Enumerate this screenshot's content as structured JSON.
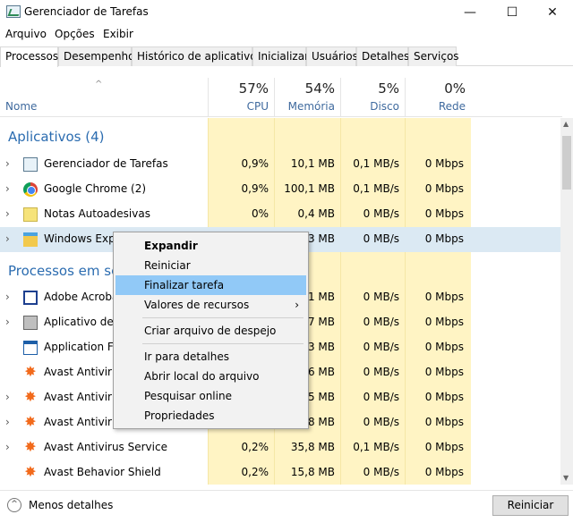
{
  "window": {
    "title": "Gerenciador de Tarefas",
    "minimize": "—",
    "maximize": "☐",
    "close": "✕"
  },
  "menu": [
    "Arquivo",
    "Opções",
    "Exibir"
  ],
  "tabs": [
    "Processos",
    "Desempenho",
    "Histórico de aplicativos",
    "Inicializar",
    "Usuários",
    "Detalhes",
    "Serviços"
  ],
  "header": {
    "name": "Nome",
    "columns": [
      {
        "pct": "57%",
        "label": "CPU"
      },
      {
        "pct": "54%",
        "label": "Memória"
      },
      {
        "pct": "5%",
        "label": "Disco"
      },
      {
        "pct": "0%",
        "label": "Rede"
      }
    ]
  },
  "groups": {
    "apps": "Aplicativos (4)",
    "background": "Processos em segundo plano"
  },
  "rows": [
    {
      "icon": "task-manager-icon",
      "name": "Gerenciador de Tarefas",
      "cpu": "0,9%",
      "mem": "10,1 MB",
      "disk": "0,1 MB/s",
      "net": "0 Mbps"
    },
    {
      "icon": "chrome-icon",
      "name": "Google Chrome (2)",
      "cpu": "0,9%",
      "mem": "100,1 MB",
      "disk": "0,1 MB/s",
      "net": "0 Mbps"
    },
    {
      "icon": "sticky-notes-icon",
      "name": "Notas Autoadesivas",
      "cpu": "0%",
      "mem": "0,4 MB",
      "disk": "0 MB/s",
      "net": "0 Mbps"
    },
    {
      "icon": "explorer-icon",
      "name": "Windows Explorer",
      "cpu": "",
      "mem": "3 MB",
      "disk": "0 MB/s",
      "net": "0 Mbps"
    },
    {
      "icon": "acrobat-icon",
      "name": "Adobe Acrobat",
      "cpu": "",
      "mem": "1 MB",
      "disk": "0 MB/s",
      "net": "0 Mbps"
    },
    {
      "icon": "printer-icon",
      "name": "Aplicativo de s",
      "cpu": "",
      "mem": "7 MB",
      "disk": "0 MB/s",
      "net": "0 Mbps"
    },
    {
      "icon": "window-icon",
      "name": "Application Fra",
      "cpu": "",
      "mem": "3 MB",
      "disk": "0 MB/s",
      "net": "0 Mbps"
    },
    {
      "icon": "avast-icon",
      "name": "Avast Antivirus",
      "cpu": "",
      "mem": "6 MB",
      "disk": "0 MB/s",
      "net": "0 Mbps"
    },
    {
      "icon": "avast-icon",
      "name": "Avast Antivirus",
      "cpu": "",
      "mem": "5 MB",
      "disk": "0 MB/s",
      "net": "0 Mbps"
    },
    {
      "icon": "avast-icon",
      "name": "Avast Antivirus",
      "cpu": "",
      "mem": "8 MB",
      "disk": "0 MB/s",
      "net": "0 Mbps"
    },
    {
      "icon": "avast-icon",
      "name": "Avast Antivirus  Service",
      "cpu": "0,2%",
      "mem": "35,8 MB",
      "disk": "0,1 MB/s",
      "net": "0 Mbps"
    },
    {
      "icon": "avast-icon",
      "name": "Avast Behavior Shield",
      "cpu": "0,2%",
      "mem": "15,8 MB",
      "disk": "0 MB/s",
      "net": "0 Mbps"
    }
  ],
  "context_menu": [
    "Expandir",
    "Reiniciar",
    "Finalizar tarefa",
    "Valores de recursos",
    "Criar arquivo de despejo",
    "Ir para detalhes",
    "Abrir local do arquivo",
    "Pesquisar online",
    "Propriedades"
  ],
  "footer": {
    "less_details": "Menos detalhes",
    "restart": "Reiniciar"
  }
}
